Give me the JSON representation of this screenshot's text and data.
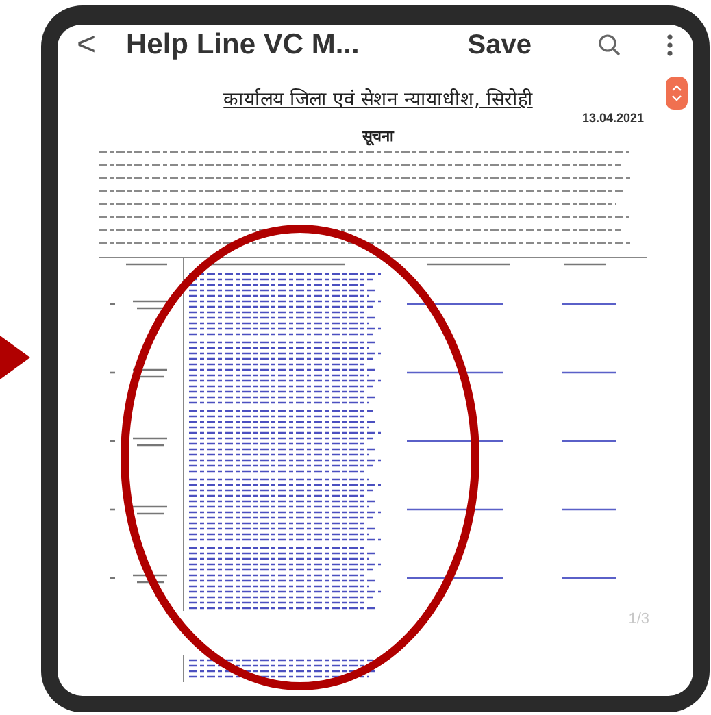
{
  "app_bar": {
    "back": "<",
    "title": "Help Line VC M...",
    "save": "Save"
  },
  "document": {
    "heading": "कार्यालय जिला एवं सेशन न्यायाधीश, सिरोही",
    "date": "13.04.2021",
    "notice": "सूचना"
  },
  "page_indicator": "1/3"
}
